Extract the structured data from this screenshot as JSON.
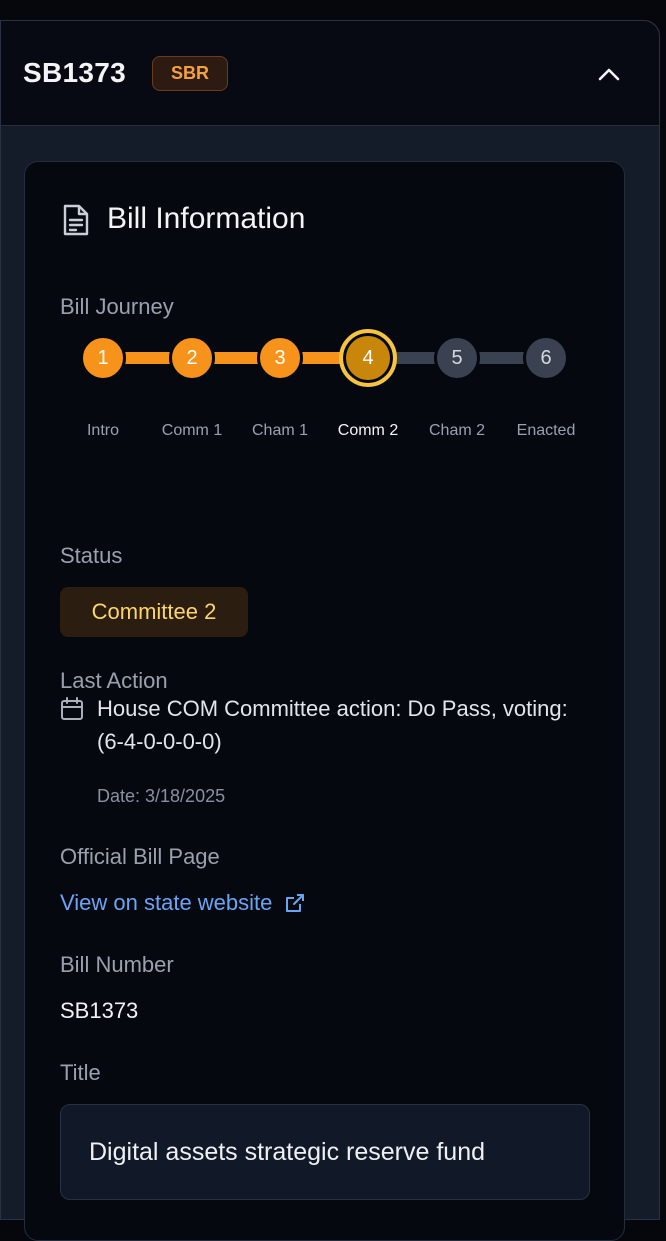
{
  "header": {
    "bill_id": "SB1373",
    "badge": "SBR",
    "collapse_icon": "chevron-up-icon"
  },
  "card": {
    "title": "Bill Information",
    "title_icon": "document-icon",
    "journey_label": "Bill Journey",
    "steps": [
      {
        "num": "1",
        "label": "Intro",
        "state": "complete"
      },
      {
        "num": "2",
        "label": "Comm 1",
        "state": "complete"
      },
      {
        "num": "3",
        "label": "Cham 1",
        "state": "complete"
      },
      {
        "num": "4",
        "label": "Comm 2",
        "state": "current"
      },
      {
        "num": "5",
        "label": "Cham 2",
        "state": "pending"
      },
      {
        "num": "6",
        "label": "Enacted",
        "state": "pending"
      }
    ],
    "status_label": "Status",
    "status_value": "Committee 2",
    "last_action_label": "Last Action",
    "last_action_icon": "calendar-icon",
    "last_action_text": "House COM Committee action: Do Pass, voting: (6-4-0-0-0-0)",
    "last_action_date": "Date: 3/18/2025",
    "official_page_label": "Official Bill Page",
    "official_page_link": "View on state website",
    "link_icon": "external-link-icon",
    "bill_number_label": "Bill Number",
    "bill_number_value": "SB1373",
    "title_label": "Title",
    "title_value": "Digital assets strategic reserve fund"
  },
  "colors": {
    "complete": "#f7931a",
    "current": "#c8870a",
    "current_ring": "#f5c542",
    "pending": "#3a4252",
    "badge_text": "#f4a33b",
    "status_text": "#fcd56a",
    "link": "#6aa5f5"
  }
}
